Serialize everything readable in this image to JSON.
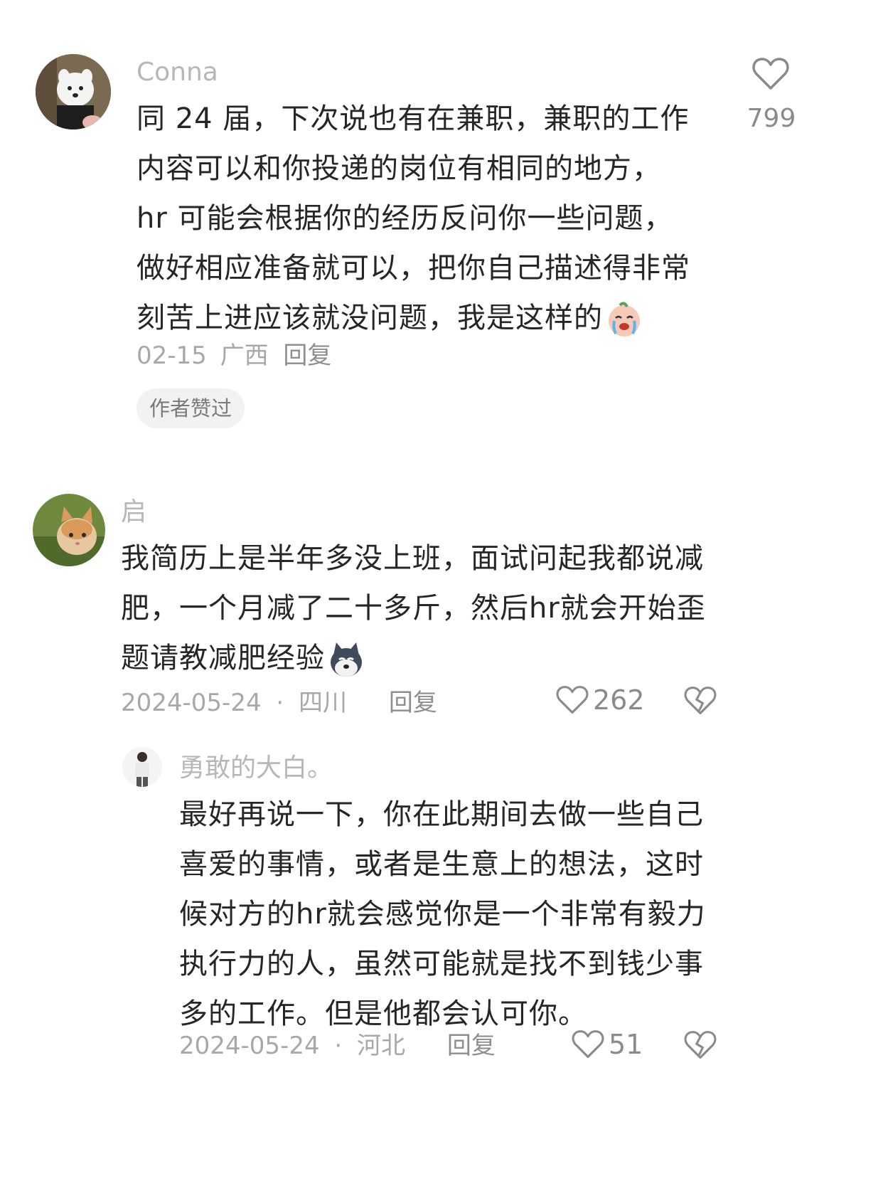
{
  "comments": [
    {
      "username": "Conna",
      "lines": [
        "同 24 届，下次说也有在兼职，兼职的工作",
        "内容可以和你投递的岗位有相同的地方，",
        "hr 可能会根据你的经历反问你一些问题，",
        "做好相应准备就可以，把你自己描述得非常",
        "刻苦上进应该就没问题，我是这样的"
      ],
      "emoji": "crying-face-emoji",
      "date": "02-15",
      "location": "广西",
      "reply_label": "回复",
      "badge": "作者赞过",
      "likes": "799",
      "avatar": "samoyed-dog-avatar"
    },
    {
      "username": "启",
      "lines": [
        "我简历上是半年多没上班，面试问起我都说减",
        "肥，一个月减了二十多斤，然后hr就会开始歪",
        "题请教减肥经验"
      ],
      "emoji": "husky-dog-emoji",
      "date": "2024-05-24",
      "separator": "·",
      "location": "四川",
      "reply_label": "回复",
      "likes": "262",
      "avatar": "orange-cat-avatar"
    },
    {
      "username": "勇敢的大白。",
      "lines": [
        "最好再说一下，你在此期间去做一些自己",
        "喜爱的事情，或者是生意上的想法，这时",
        "候对方的hr就会感觉你是一个非常有毅力",
        "执行力的人，虽然可能就是找不到钱少事",
        "多的工作。但是他都会认可你。"
      ],
      "date": "2024-05-24",
      "separator": "·",
      "location": "河北",
      "reply_label": "回复",
      "likes": "51",
      "avatar": "man-standing-avatar"
    }
  ],
  "icons": {
    "like": "heart-outline-icon",
    "dislike": "broken-heart-icon"
  },
  "colors": {
    "muted_text": "#a8a8a8",
    "body_text": "#262626",
    "badge_bg": "#f2f2f2"
  }
}
